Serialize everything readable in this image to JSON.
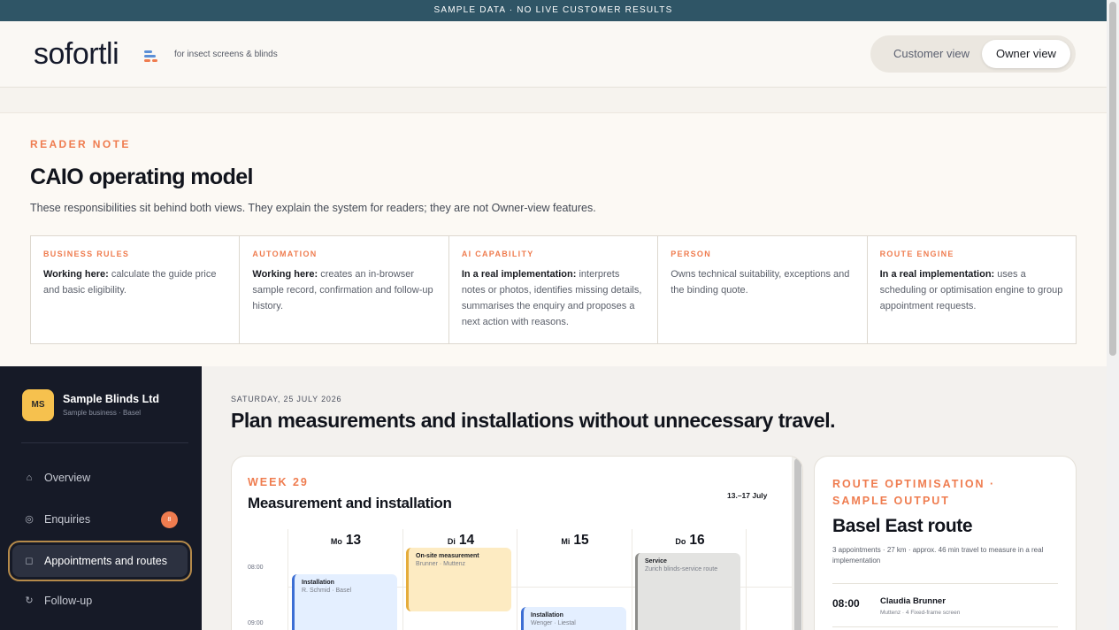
{
  "banner": {
    "text": "SAMPLE DATA · NO LIVE CUSTOMER RESULTS"
  },
  "header": {
    "logo": "sofortli",
    "tagline": "for insect screens & blinds",
    "views": {
      "customer": "Customer view",
      "owner": "Owner view",
      "selected": "Owner view"
    }
  },
  "reader_note": {
    "eyebrow": "READER NOTE",
    "title": "CAIO operating model",
    "description": "These responsibilities sit behind both views. They explain the system for readers; they are not Owner-view features.",
    "cards": [
      {
        "label": "BUSINESS RULES",
        "lead": "Working here:",
        "text": "calculate the guide price and basic eligibility."
      },
      {
        "label": "AUTOMATION",
        "lead": "Working here:",
        "text": "creates an in-browser sample record, confirmation and follow-up history."
      },
      {
        "label": "AI CAPABILITY",
        "lead": "In a real implementation:",
        "text": "interprets notes or photos, identifies missing details, summarises the enquiry and proposes a next action with reasons."
      },
      {
        "label": "PERSON",
        "lead": "",
        "text": "Owns technical suitability, exceptions and the binding quote."
      },
      {
        "label": "ROUTE ENGINE",
        "lead": "In a real implementation:",
        "text": "uses a scheduling or optimisation engine to group appointment requests."
      }
    ]
  },
  "sidebar": {
    "business": {
      "initials": "MS",
      "name": "Sample Blinds Ltd",
      "subtitle": "Sample business · Basel"
    },
    "items": [
      {
        "label": "Overview",
        "icon": "home-icon",
        "glyph": "⌂"
      },
      {
        "label": "Enquiries",
        "icon": "inbox-icon",
        "glyph": "◎",
        "badge": "8"
      },
      {
        "label": "Appointments and routes",
        "icon": "calendar-icon",
        "glyph": "◻",
        "active": true
      },
      {
        "label": "Follow-up",
        "icon": "refresh-icon",
        "glyph": "↻"
      }
    ]
  },
  "main": {
    "date": "SATURDAY, 25 JULY 2026",
    "title": "Plan measurements and installations without unnecessary travel."
  },
  "calendar": {
    "eyebrow": "WEEK 29",
    "title": "Measurement and installation",
    "range": "13.–17 July",
    "times": [
      "08:00",
      "09:00"
    ],
    "days": [
      {
        "name": "Mo",
        "date": "13"
      },
      {
        "name": "Di",
        "date": "14"
      },
      {
        "name": "Mi",
        "date": "15"
      },
      {
        "name": "Do",
        "date": "16"
      },
      {
        "name": "F",
        "date": ""
      }
    ],
    "appointments": [
      {
        "title": "Installation",
        "sub": "R. Schmid · Basel",
        "kind": "installation"
      },
      {
        "title": "On-site measurement",
        "sub": "Brunner · Muttenz",
        "kind": "measurement"
      },
      {
        "title": "Installation",
        "sub": "Wenger · Liestal",
        "kind": "installation"
      },
      {
        "title": "Service",
        "sub": "Zurich blinds-service route",
        "kind": "service"
      }
    ]
  },
  "route": {
    "eyebrow": "ROUTE OPTIMISATION · SAMPLE OUTPUT",
    "title": "Basel East route",
    "summary": "3 appointments · 27 km · approx. 46 min travel to measure in a real implementation",
    "stops": [
      {
        "time": "08:00",
        "name": "Claudia Brunner",
        "detail": "Muttenz · 4 Fixed-frame screen"
      }
    ]
  },
  "colors": {
    "accent": "#ef7c4f",
    "banner": "#2f5566",
    "sidebar": "#161a27",
    "badge": "#f6c14e",
    "installation": "#e4efff",
    "measurement": "#fdebc2",
    "service": "#e3e3e1"
  }
}
